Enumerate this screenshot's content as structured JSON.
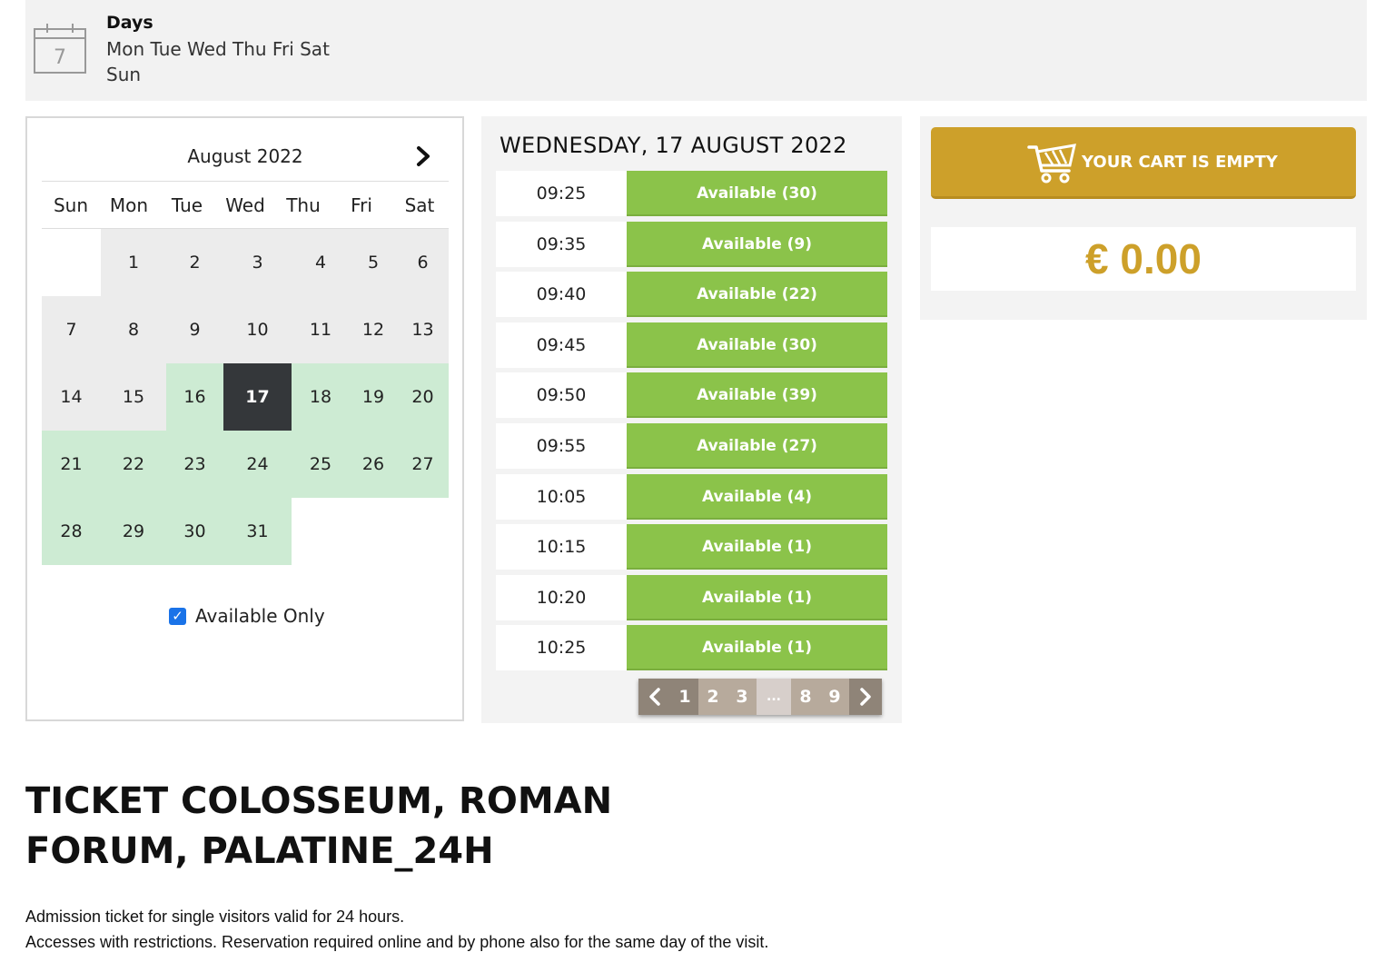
{
  "days_bar": {
    "icon": "calendar-icon",
    "icon_number": "7",
    "title": "Days",
    "days": "Mon Tue Wed Thu Fri Sat Sun"
  },
  "calendar": {
    "month": "August 2022",
    "next_icon": "chevron-right-icon",
    "weekdays": [
      "Sun",
      "Mon",
      "Tue",
      "Wed",
      "Thu",
      "Fri",
      "Sat"
    ],
    "weeks": [
      [
        {
          "day": "",
          "state": "empty"
        },
        {
          "day": "1",
          "state": "gray"
        },
        {
          "day": "2",
          "state": "gray"
        },
        {
          "day": "3",
          "state": "gray"
        },
        {
          "day": "4",
          "state": "gray"
        },
        {
          "day": "5",
          "state": "gray"
        },
        {
          "day": "6",
          "state": "gray"
        }
      ],
      [
        {
          "day": "7",
          "state": "gray"
        },
        {
          "day": "8",
          "state": "gray"
        },
        {
          "day": "9",
          "state": "gray"
        },
        {
          "day": "10",
          "state": "gray"
        },
        {
          "day": "11",
          "state": "gray"
        },
        {
          "day": "12",
          "state": "gray"
        },
        {
          "day": "13",
          "state": "gray"
        }
      ],
      [
        {
          "day": "14",
          "state": "gray"
        },
        {
          "day": "15",
          "state": "gray"
        },
        {
          "day": "16",
          "state": "green"
        },
        {
          "day": "17",
          "state": "sel"
        },
        {
          "day": "18",
          "state": "green"
        },
        {
          "day": "19",
          "state": "green"
        },
        {
          "day": "20",
          "state": "green"
        }
      ],
      [
        {
          "day": "21",
          "state": "green"
        },
        {
          "day": "22",
          "state": "green"
        },
        {
          "day": "23",
          "state": "green"
        },
        {
          "day": "24",
          "state": "green"
        },
        {
          "day": "25",
          "state": "green"
        },
        {
          "day": "26",
          "state": "green"
        },
        {
          "day": "27",
          "state": "green"
        }
      ],
      [
        {
          "day": "28",
          "state": "green"
        },
        {
          "day": "29",
          "state": "green"
        },
        {
          "day": "30",
          "state": "green"
        },
        {
          "day": "31",
          "state": "green"
        },
        {
          "day": "",
          "state": "empty"
        },
        {
          "day": "",
          "state": "empty"
        },
        {
          "day": "",
          "state": "empty"
        }
      ]
    ],
    "available_only_label": "Available Only",
    "available_only_checked": true
  },
  "slots": {
    "title": "WEDNESDAY, 17 AUGUST 2022",
    "items": [
      {
        "time": "09:25",
        "label": "Available (30)"
      },
      {
        "time": "09:35",
        "label": "Available (9)"
      },
      {
        "time": "09:40",
        "label": "Available (22)"
      },
      {
        "time": "09:45",
        "label": "Available (30)"
      },
      {
        "time": "09:50",
        "label": "Available (39)"
      },
      {
        "time": "09:55",
        "label": "Available (27)"
      },
      {
        "time": "10:05",
        "label": "Available (4)"
      },
      {
        "time": "10:15",
        "label": "Available (1)"
      },
      {
        "time": "10:20",
        "label": "Available (1)"
      },
      {
        "time": "10:25",
        "label": "Available (1)"
      }
    ],
    "pager": {
      "prev_icon": "chevron-left-icon",
      "next_icon": "chevron-right-icon",
      "pages": [
        "1",
        "2",
        "3",
        "...",
        "8",
        "9"
      ],
      "current": "1"
    }
  },
  "cart": {
    "icon": "shopping-cart-icon",
    "label": "YOUR CART IS EMPTY",
    "total": "€ 0.00"
  },
  "product": {
    "title": "TICKET COLOSSEUM, ROMAN FORUM, PALATINE_24H",
    "description_line1": "Admission ticket for single visitors valid for 24 hours.",
    "description_line2": "Accesses with restrictions. Reservation required online and by phone also for the same day of the visit."
  },
  "colors": {
    "available_green": "#8bc34a",
    "calendar_available": "#cdebd3",
    "calendar_selected": "#34373a",
    "cart_gold": "#cda02a",
    "pager_brown": "#8f8478"
  }
}
